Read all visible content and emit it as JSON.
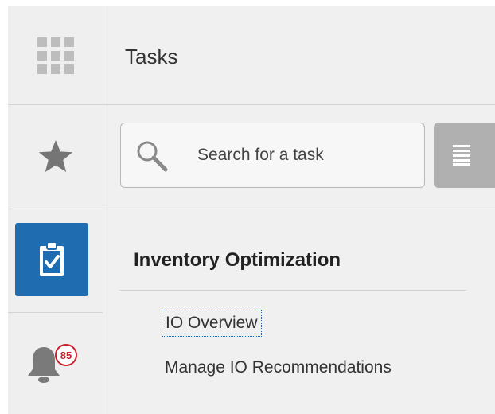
{
  "rail": {
    "items": [
      {
        "name": "navigator",
        "icon": "grid-icon"
      },
      {
        "name": "favorites",
        "icon": "star-icon"
      },
      {
        "name": "tasks",
        "icon": "clipboard-check-icon",
        "active": true
      },
      {
        "name": "notifications",
        "icon": "bell-icon",
        "badge": "85"
      }
    ]
  },
  "header": {
    "title": "Tasks"
  },
  "search": {
    "placeholder": "Search for a task",
    "value": ""
  },
  "section": {
    "heading": "Inventory Optimization",
    "tasks": [
      {
        "label": "IO Overview",
        "focused": true
      },
      {
        "label": "Manage IO Recommendations",
        "focused": false
      }
    ]
  },
  "colors": {
    "accent": "#1f6cb0",
    "badge": "#c8202c",
    "rail_icon": "#7a7a7a",
    "background": "#f0f0f0"
  }
}
